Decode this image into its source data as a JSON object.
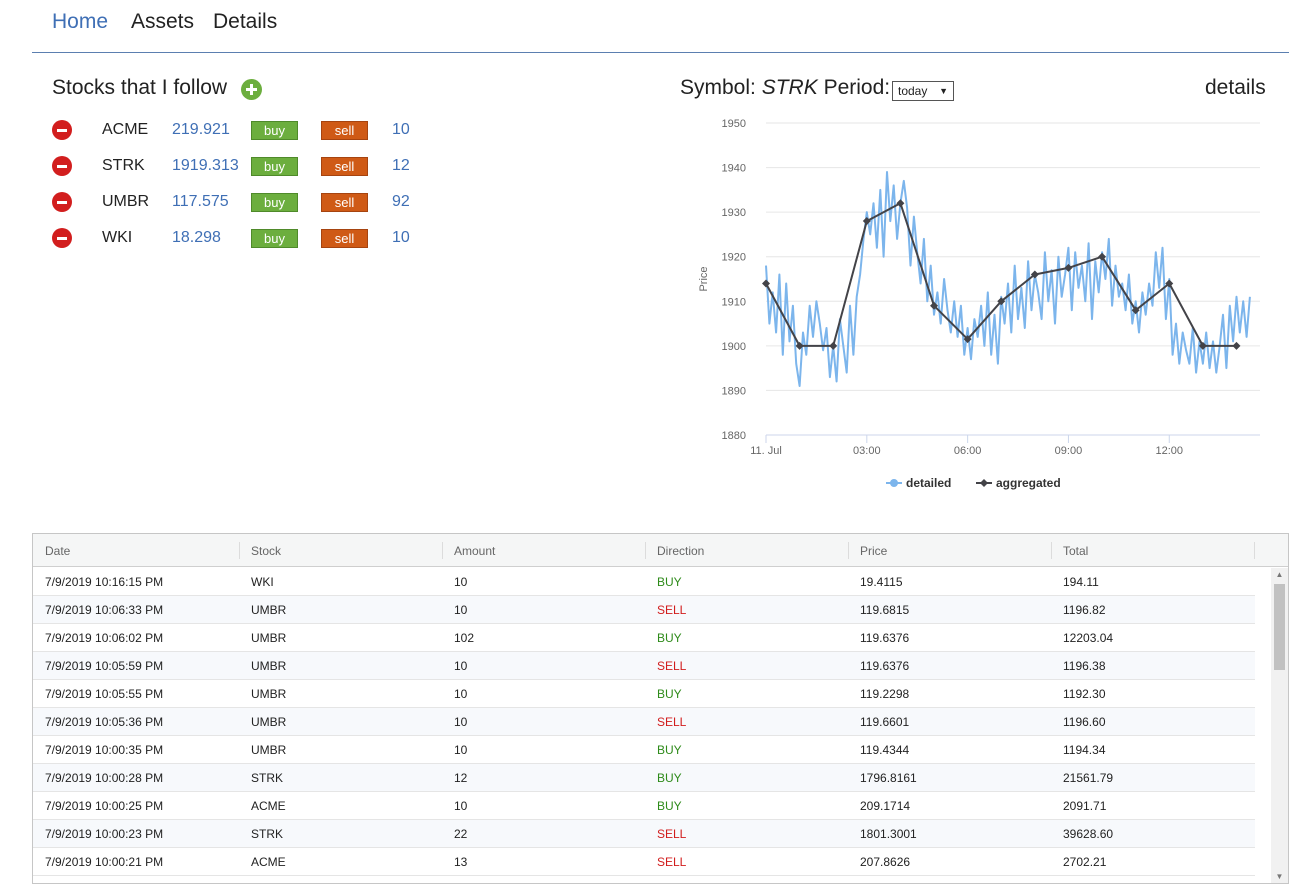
{
  "nav": {
    "home": "Home",
    "assets": "Assets",
    "details": "Details"
  },
  "stocks": {
    "title": "Stocks that I follow",
    "buy_label": "buy",
    "sell_label": "sell",
    "items": [
      {
        "symbol": "ACME",
        "price": "219.921",
        "qty": "10"
      },
      {
        "symbol": "STRK",
        "price": "1919.313",
        "qty": "12"
      },
      {
        "symbol": "UMBR",
        "price": "117.575",
        "qty": "92"
      },
      {
        "symbol": "WKI",
        "price": "18.298",
        "qty": "10"
      }
    ]
  },
  "chart_header": {
    "symbol_label": "Symbol:",
    "symbol": "STRK",
    "period_label": "Period:",
    "period_value": "today",
    "details_link": "details"
  },
  "colors": {
    "accent": "#3f6fb5",
    "buy": "#6cae3e",
    "sell": "#cf5a16",
    "remove": "#d21e1e",
    "detailed_series": "#7cb5ec",
    "aggregated_series": "#434348"
  },
  "icons": {
    "add": "plus-circle-icon",
    "remove": "minus-circle-icon",
    "dropdown": "caret-down-icon",
    "scroll_up": "chevron-up-icon",
    "scroll_down": "chevron-down-icon"
  },
  "chart_data": {
    "type": "line",
    "ylabel": "Price",
    "ylim": [
      1880,
      1950
    ],
    "yticks": [
      "1950",
      "1940",
      "1930",
      "1920",
      "1910",
      "1900",
      "1890",
      "1880"
    ],
    "xlim": [
      0,
      14.7
    ],
    "xticks": [
      {
        "x": 0,
        "label": "11. Jul"
      },
      {
        "x": 3,
        "label": "03:00"
      },
      {
        "x": 6,
        "label": "06:00"
      },
      {
        "x": 9,
        "label": "09:00"
      },
      {
        "x": 12,
        "label": "12:00"
      }
    ],
    "grid": true,
    "legend": "bottom-center",
    "series": [
      {
        "name": "detailed",
        "x": [
          0.0,
          0.1,
          0.2,
          0.3,
          0.4,
          0.5,
          0.6,
          0.7,
          0.8,
          0.9,
          1.0,
          1.1,
          1.2,
          1.3,
          1.4,
          1.5,
          1.6,
          1.7,
          1.8,
          1.9,
          2.0,
          2.1,
          2.2,
          2.3,
          2.4,
          2.5,
          2.6,
          2.7,
          2.8,
          2.9,
          3.0,
          3.1,
          3.2,
          3.3,
          3.4,
          3.5,
          3.6,
          3.7,
          3.8,
          3.9,
          4.0,
          4.1,
          4.2,
          4.3,
          4.4,
          4.5,
          4.6,
          4.7,
          4.8,
          4.9,
          5.0,
          5.1,
          5.2,
          5.3,
          5.4,
          5.5,
          5.6,
          5.7,
          5.8,
          5.9,
          6.0,
          6.1,
          6.2,
          6.3,
          6.4,
          6.5,
          6.6,
          6.7,
          6.8,
          6.9,
          7.0,
          7.1,
          7.2,
          7.3,
          7.4,
          7.5,
          7.6,
          7.7,
          7.8,
          7.9,
          8.0,
          8.1,
          8.2,
          8.3,
          8.4,
          8.5,
          8.6,
          8.7,
          8.8,
          8.9,
          9.0,
          9.1,
          9.2,
          9.3,
          9.4,
          9.5,
          9.6,
          9.7,
          9.8,
          9.9,
          10.0,
          10.1,
          10.2,
          10.3,
          10.4,
          10.5,
          10.6,
          10.7,
          10.8,
          10.9,
          11.0,
          11.1,
          11.2,
          11.3,
          11.4,
          11.5,
          11.6,
          11.7,
          11.8,
          11.9,
          12.0,
          12.1,
          12.2,
          12.3,
          12.4,
          12.5,
          12.6,
          12.7,
          12.8,
          12.9,
          13.0,
          13.1,
          13.2,
          13.3,
          13.4,
          13.5,
          13.6,
          13.7,
          13.8,
          13.9,
          14.0,
          14.1,
          14.2,
          14.3,
          14.4
        ],
        "values": [
          1918,
          1905,
          1912,
          1903,
          1916,
          1898,
          1914,
          1901,
          1909,
          1896,
          1891,
          1903,
          1898,
          1909,
          1902,
          1910,
          1905,
          1899,
          1904,
          1893,
          1900,
          1892,
          1906,
          1900,
          1894,
          1909,
          1898,
          1911,
          1916,
          1924,
          1930,
          1925,
          1932,
          1922,
          1935,
          1920,
          1939,
          1928,
          1936,
          1924,
          1932,
          1937,
          1931,
          1918,
          1929,
          1921,
          1914,
          1924,
          1910,
          1918,
          1907,
          1912,
          1905,
          1915,
          1908,
          1903,
          1910,
          1902,
          1909,
          1898,
          1904,
          1897,
          1906,
          1902,
          1909,
          1900,
          1912,
          1898,
          1907,
          1896,
          1911,
          1905,
          1914,
          1903,
          1918,
          1906,
          1913,
          1904,
          1919,
          1908,
          1916,
          1912,
          1906,
          1921,
          1910,
          1917,
          1905,
          1920,
          1911,
          1916,
          1922,
          1908,
          1921,
          1913,
          1918,
          1910,
          1923,
          1906,
          1919,
          1912,
          1921,
          1915,
          1924,
          1909,
          1918,
          1911,
          1914,
          1908,
          1916,
          1905,
          1910,
          1903,
          1912,
          1907,
          1914,
          1909,
          1921,
          1913,
          1922,
          1906,
          1915,
          1898,
          1905,
          1896,
          1903,
          1899,
          1896,
          1904,
          1894,
          1901,
          1896,
          1903,
          1895,
          1901,
          1894,
          1900,
          1907,
          1895,
          1909,
          1901,
          1911,
          1903,
          1910,
          1902,
          1911
        ]
      },
      {
        "name": "aggregated",
        "x": [
          0,
          1,
          2,
          3,
          4,
          5,
          6,
          7,
          8,
          9,
          10,
          11,
          12,
          13,
          14
        ],
        "values": [
          1914,
          1900,
          1900,
          1928,
          1932,
          1909,
          1901.5,
          1910,
          1916,
          1917.5,
          1920,
          1908,
          1914,
          1900,
          1900
        ]
      }
    ]
  },
  "table": {
    "columns": [
      "Date",
      "Stock",
      "Amount",
      "Direction",
      "Price",
      "Total"
    ],
    "rows": [
      [
        "7/9/2019 10:16:15 PM",
        "WKI",
        "10",
        "BUY",
        "19.4115",
        "194.11"
      ],
      [
        "7/9/2019 10:06:33 PM",
        "UMBR",
        "10",
        "SELL",
        "119.6815",
        "1196.82"
      ],
      [
        "7/9/2019 10:06:02 PM",
        "UMBR",
        "102",
        "BUY",
        "119.6376",
        "12203.04"
      ],
      [
        "7/9/2019 10:05:59 PM",
        "UMBR",
        "10",
        "SELL",
        "119.6376",
        "1196.38"
      ],
      [
        "7/9/2019 10:05:55 PM",
        "UMBR",
        "10",
        "BUY",
        "119.2298",
        "1192.30"
      ],
      [
        "7/9/2019 10:05:36 PM",
        "UMBR",
        "10",
        "SELL",
        "119.6601",
        "1196.60"
      ],
      [
        "7/9/2019 10:00:35 PM",
        "UMBR",
        "10",
        "BUY",
        "119.4344",
        "1194.34"
      ],
      [
        "7/9/2019 10:00:28 PM",
        "STRK",
        "12",
        "BUY",
        "1796.8161",
        "21561.79"
      ],
      [
        "7/9/2019 10:00:25 PM",
        "ACME",
        "10",
        "BUY",
        "209.1714",
        "2091.71"
      ],
      [
        "7/9/2019 10:00:23 PM",
        "STRK",
        "22",
        "SELL",
        "1801.3001",
        "39628.60"
      ],
      [
        "7/9/2019 10:00:21 PM",
        "ACME",
        "13",
        "SELL",
        "207.8626",
        "2702.21"
      ]
    ]
  }
}
